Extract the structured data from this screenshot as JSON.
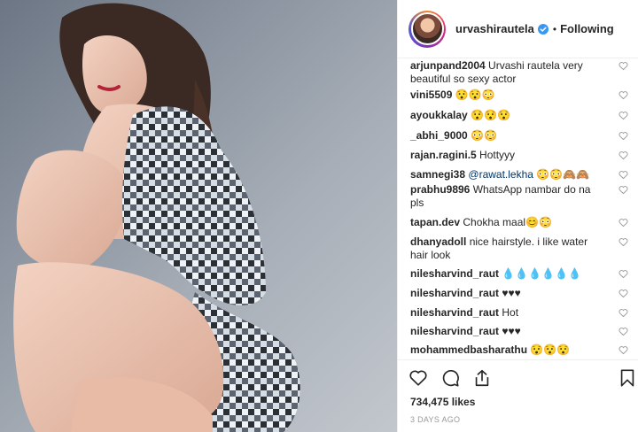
{
  "header": {
    "username": "urvashirautela",
    "separator": "•",
    "follow_status": "Following",
    "verified": true
  },
  "comments": [
    {
      "user": "arjunpand2004",
      "text": "Urvashi rautela very beautiful so sexy actor"
    },
    {
      "user": "vini5509",
      "text": "😯😯😳"
    },
    {
      "user": "ayoukkalay",
      "text": "😯😯😯"
    },
    {
      "user": "_abhi_9000",
      "text": "😳😳"
    },
    {
      "user": "rajan.ragini.5",
      "text": "Hottyyy"
    },
    {
      "user": "samnegi38",
      "mention": "@rawat.lekha",
      "text": "😳😳🙈🙈"
    },
    {
      "user": "prabhu9896",
      "text": "WhatsApp nambar do na pls"
    },
    {
      "user": "tapan.dev",
      "text": "Chokha maal😊😳"
    },
    {
      "user": "dhanyadoll",
      "text": "nice hairstyle. i like water hair look"
    },
    {
      "user": "nilesharvind_raut",
      "text": "💧💧💧💧💧💧"
    },
    {
      "user": "nilesharvind_raut",
      "text": "♥♥♥"
    },
    {
      "user": "nilesharvind_raut",
      "text": "Hot"
    },
    {
      "user": "nilesharvind_raut",
      "text": "♥♥♥"
    },
    {
      "user": "mohammedbasharathu",
      "text": "😯😯😯"
    }
  ],
  "actions": {
    "icons": [
      "heart-icon",
      "comment-icon",
      "share-icon",
      "bookmark-icon"
    ]
  },
  "likes": "734,475 likes",
  "timestamp": "3 DAYS AGO",
  "colors": {
    "text": "#262626",
    "muted": "#999999",
    "verified": "#3897f0",
    "mention": "#003569"
  }
}
